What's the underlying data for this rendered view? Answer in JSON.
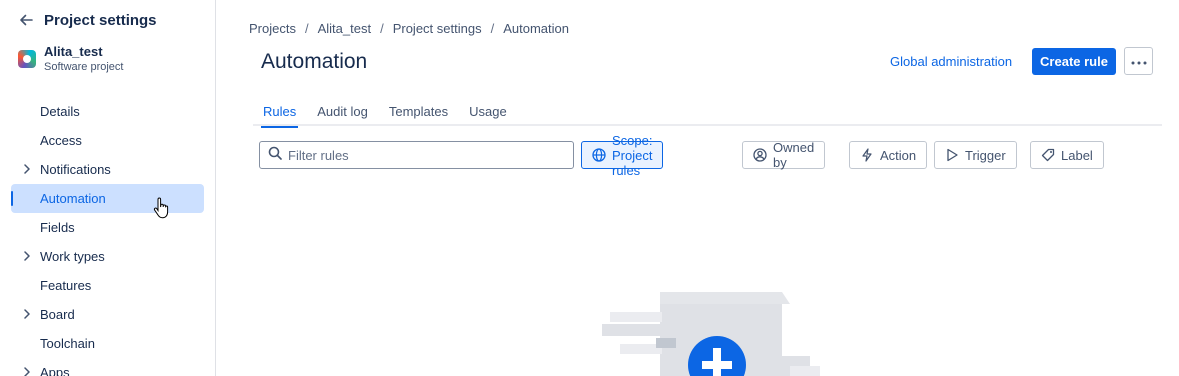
{
  "sidebar": {
    "title": "Project settings",
    "project": {
      "name": "Alita_test",
      "type": "Software project"
    },
    "items": [
      {
        "label": "Details",
        "has_children": false,
        "active": false
      },
      {
        "label": "Access",
        "has_children": false,
        "active": false
      },
      {
        "label": "Notifications",
        "has_children": true,
        "active": false
      },
      {
        "label": "Automation",
        "has_children": false,
        "active": true
      },
      {
        "label": "Fields",
        "has_children": false,
        "active": false
      },
      {
        "label": "Work types",
        "has_children": true,
        "active": false
      },
      {
        "label": "Features",
        "has_children": false,
        "active": false
      },
      {
        "label": "Board",
        "has_children": true,
        "active": false
      },
      {
        "label": "Toolchain",
        "has_children": false,
        "active": false
      },
      {
        "label": "Apps",
        "has_children": true,
        "active": false
      }
    ]
  },
  "breadcrumb": [
    "Projects",
    "Alita_test",
    "Project settings",
    "Automation"
  ],
  "header": {
    "title": "Automation",
    "global_admin_label": "Global administration",
    "create_rule_label": "Create rule",
    "more_icon": "ellipsis-icon"
  },
  "tabs": [
    {
      "label": "Rules",
      "active": true
    },
    {
      "label": "Audit log",
      "active": false
    },
    {
      "label": "Templates",
      "active": false
    },
    {
      "label": "Usage",
      "active": false
    }
  ],
  "filters": {
    "search_placeholder": "Filter rules",
    "scope_label": "Scope: Project rules",
    "owned_by_label": "Owned by",
    "action_label": "Action",
    "trigger_label": "Trigger",
    "label_label": "Label"
  },
  "colors": {
    "accent": "#0c66e4",
    "active_nav_bg": "#cce0ff",
    "scope_chip_bg": "#e9f2ff",
    "text": "#172b4d"
  }
}
